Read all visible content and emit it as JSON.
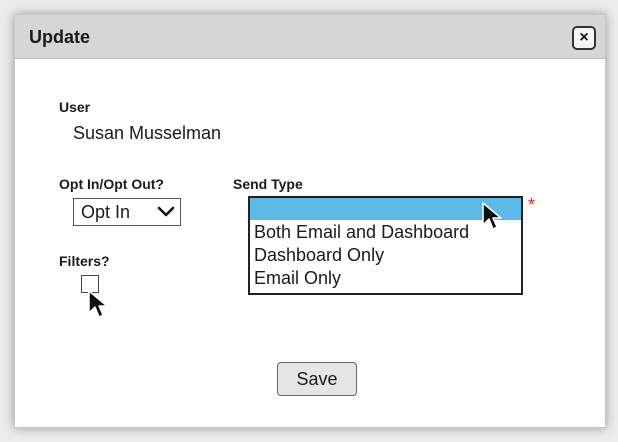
{
  "dialog": {
    "title": "Update",
    "close_label": "×"
  },
  "user": {
    "label": "User",
    "value": "Susan Musselman"
  },
  "opt": {
    "label": "Opt In/Opt Out?",
    "selected": "Opt In"
  },
  "send_type": {
    "label": "Send Type",
    "required_marker": "*",
    "options": [
      "",
      "Both Email and Dashboard",
      "Dashboard Only",
      "Email Only"
    ]
  },
  "filters": {
    "label": "Filters?"
  },
  "actions": {
    "save_label": "Save"
  },
  "colors": {
    "titlebar": "#d6d6d6",
    "selection": "#5cb8e6",
    "required": "#e0261b"
  },
  "icons": [
    "close-icon",
    "chevron-down-icon",
    "cursor-icon"
  ]
}
